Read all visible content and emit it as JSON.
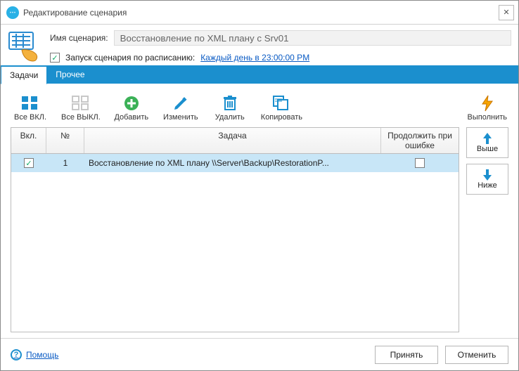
{
  "window": {
    "title": "Редактирование сценария"
  },
  "header": {
    "name_label": "Имя сценария:",
    "name_value": "Восстановление по XML плану с Srv01",
    "schedule_checkbox_label": "Запуск сценария по расписанию:",
    "schedule_link": "Каждый день в 23:00:00 PM",
    "schedule_checked": true
  },
  "tabs": {
    "items": [
      {
        "label": "Задачи",
        "active": true
      },
      {
        "label": "Прочее",
        "active": false
      }
    ]
  },
  "toolbar": {
    "all_on": "Все ВКЛ.",
    "all_off": "Все ВЫКЛ.",
    "add": "Добавить",
    "edit": "Изменить",
    "delete": "Удалить",
    "copy": "Копировать",
    "execute": "Выполнить"
  },
  "grid": {
    "headers": {
      "enabled": "Вкл.",
      "number": "№",
      "task": "Задача",
      "continue_on_error": "Продолжить при ошибке"
    },
    "rows": [
      {
        "enabled": true,
        "number": "1",
        "task": "Восстановление  по  XML  плану  \\\\Server\\Backup\\RestorationP...",
        "continue_on_error": false
      }
    ]
  },
  "side": {
    "up": "Выше",
    "down": "Ниже"
  },
  "footer": {
    "help": "Помощь",
    "accept": "Принять",
    "cancel": "Отменить"
  }
}
